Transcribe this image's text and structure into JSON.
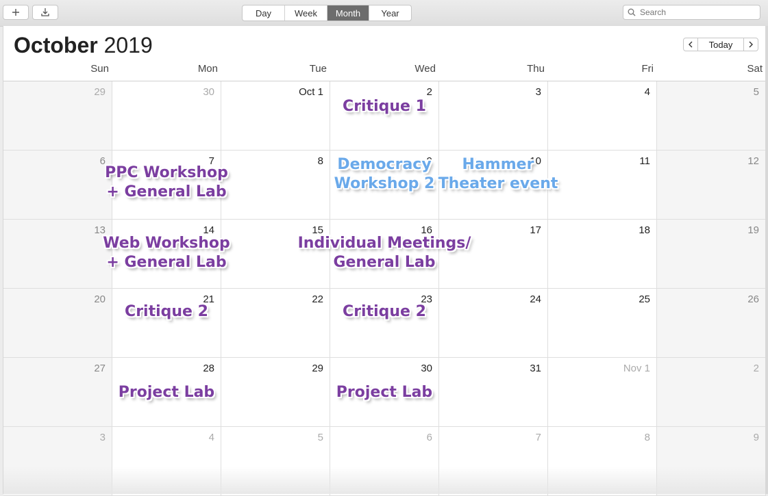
{
  "toolbar": {
    "add_icon": "plus-icon",
    "import_icon": "download-tray-icon",
    "views": [
      {
        "label": "Day",
        "active": false
      },
      {
        "label": "Week",
        "active": false
      },
      {
        "label": "Month",
        "active": true
      },
      {
        "label": "Year",
        "active": false
      }
    ],
    "search_placeholder": "Search"
  },
  "header": {
    "month": "October",
    "year": "2019",
    "prev_icon": "chevron-left-icon",
    "today_label": "Today",
    "next_icon": "chevron-right-icon"
  },
  "days_of_week": [
    "Sun",
    "Mon",
    "Tue",
    "Wed",
    "Thu",
    "Fri",
    "Sat"
  ],
  "weeks": [
    [
      {
        "label": "29",
        "other": true
      },
      {
        "label": "30",
        "other": true
      },
      {
        "label": "Oct 1",
        "other": false
      },
      {
        "label": "2",
        "other": false
      },
      {
        "label": "3",
        "other": false
      },
      {
        "label": "4",
        "other": false
      },
      {
        "label": "5",
        "other": false
      }
    ],
    [
      {
        "label": "6",
        "other": false
      },
      {
        "label": "7",
        "other": false
      },
      {
        "label": "8",
        "other": false
      },
      {
        "label": "9",
        "other": false
      },
      {
        "label": "10",
        "other": false
      },
      {
        "label": "11",
        "other": false
      },
      {
        "label": "12",
        "other": false
      }
    ],
    [
      {
        "label": "13",
        "other": false
      },
      {
        "label": "14",
        "other": false
      },
      {
        "label": "15",
        "other": false
      },
      {
        "label": "16",
        "other": false
      },
      {
        "label": "17",
        "other": false
      },
      {
        "label": "18",
        "other": false
      },
      {
        "label": "19",
        "other": false
      }
    ],
    [
      {
        "label": "20",
        "other": false
      },
      {
        "label": "21",
        "other": false
      },
      {
        "label": "22",
        "other": false
      },
      {
        "label": "23",
        "other": false
      },
      {
        "label": "24",
        "other": false
      },
      {
        "label": "25",
        "other": false
      },
      {
        "label": "26",
        "other": false
      }
    ],
    [
      {
        "label": "27",
        "other": false
      },
      {
        "label": "28",
        "other": false
      },
      {
        "label": "29",
        "other": false
      },
      {
        "label": "30",
        "other": false
      },
      {
        "label": "31",
        "other": false
      },
      {
        "label": "Nov 1",
        "other": true
      },
      {
        "label": "2",
        "other": true
      }
    ],
    [
      {
        "label": "3",
        "other": true
      },
      {
        "label": "4",
        "other": true
      },
      {
        "label": "5",
        "other": true
      },
      {
        "label": "6",
        "other": true
      },
      {
        "label": "7",
        "other": true
      },
      {
        "label": "8",
        "other": true
      },
      {
        "label": "9",
        "other": true
      }
    ]
  ],
  "events": [
    {
      "text": "Critique 1",
      "color": "#7b3ea0"
    },
    {
      "text": "PPC Workshop\n+ General Lab",
      "color": "#7b3ea0"
    },
    {
      "text": "Democracy\nWorkshop 2",
      "color": "#6aa9ea"
    },
    {
      "text": "Hammer\nTheater event",
      "color": "#6aa9ea"
    },
    {
      "text": "Web Workshop\n+ General Lab",
      "color": "#7b3ea0"
    },
    {
      "text": "Individual Meetings/\nGeneral Lab",
      "color": "#7b3ea0"
    },
    {
      "text": "Critique 2",
      "color": "#7b3ea0"
    },
    {
      "text": "Critique 2",
      "color": "#7b3ea0"
    },
    {
      "text": "Project Lab",
      "color": "#7b3ea0"
    },
    {
      "text": "Project Lab",
      "color": "#7b3ea0"
    }
  ]
}
